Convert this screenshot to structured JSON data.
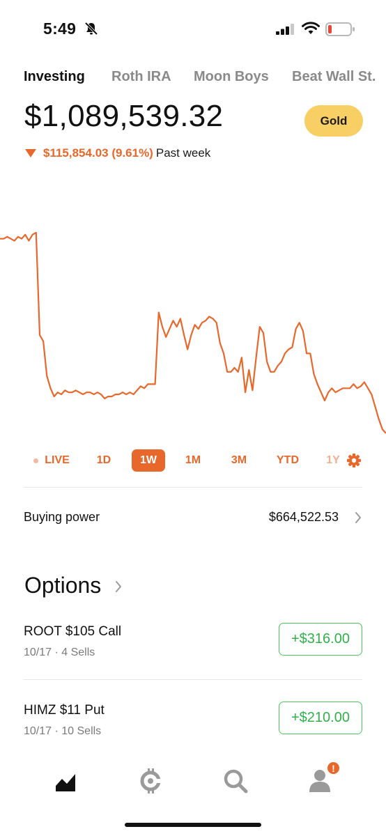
{
  "status_bar": {
    "time": "5:49"
  },
  "account_tabs": [
    {
      "label": "Investing",
      "active": true
    },
    {
      "label": "Roth IRA",
      "active": false
    },
    {
      "label": "Moon Boys",
      "active": false
    },
    {
      "label": "Beat Wall St.",
      "active": false
    }
  ],
  "portfolio": {
    "balance": "$1,089,539.32",
    "gold_label": "Gold",
    "change": "$115,854.03 (9.61%)",
    "change_period": "Past week",
    "change_direction": "down"
  },
  "chart_data": {
    "type": "line",
    "range": "1W",
    "color": "#e8672b",
    "y_relative": [
      0.95,
      0.95,
      0.96,
      0.95,
      0.94,
      0.96,
      0.95,
      0.97,
      0.94,
      0.97,
      0.98,
      0.48,
      0.45,
      0.28,
      0.22,
      0.18,
      0.2,
      0.19,
      0.21,
      0.2,
      0.2,
      0.21,
      0.2,
      0.19,
      0.2,
      0.2,
      0.19,
      0.2,
      0.19,
      0.17,
      0.18,
      0.18,
      0.19,
      0.19,
      0.2,
      0.19,
      0.2,
      0.19,
      0.21,
      0.23,
      0.22,
      0.24,
      0.24,
      0.24,
      0.59,
      0.52,
      0.47,
      0.51,
      0.55,
      0.52,
      0.56,
      0.48,
      0.41,
      0.48,
      0.53,
      0.51,
      0.54,
      0.55,
      0.57,
      0.56,
      0.54,
      0.44,
      0.39,
      0.3,
      0.3,
      0.32,
      0.3,
      0.37,
      0.2,
      0.31,
      0.21,
      0.37,
      0.52,
      0.49,
      0.35,
      0.3,
      0.3,
      0.33,
      0.35,
      0.39,
      0.41,
      0.42,
      0.51,
      0.54,
      0.5,
      0.39,
      0.39,
      0.29,
      0.24,
      0.2,
      0.16,
      0.2,
      0.22,
      0.2,
      0.21,
      0.22,
      0.22,
      0.22,
      0.24,
      0.22,
      0.23,
      0.25,
      0.22,
      0.19,
      0.13,
      0.07,
      0.02,
      0.0
    ]
  },
  "ranges": [
    {
      "label": "LIVE",
      "selected": false
    },
    {
      "label": "1D",
      "selected": false
    },
    {
      "label": "1W",
      "selected": true
    },
    {
      "label": "1M",
      "selected": false
    },
    {
      "label": "3M",
      "selected": false
    },
    {
      "label": "YTD",
      "selected": false
    },
    {
      "label": "1Y",
      "selected": false
    }
  ],
  "buying_power": {
    "label": "Buying power",
    "value": "$664,522.53"
  },
  "options": {
    "title": "Options",
    "positions": [
      {
        "name": "ROOT $105 Call",
        "detail": "10/17 · 4 Sells",
        "pl": "+$316.00"
      },
      {
        "name": "HIMZ $11 Put",
        "detail": "10/17 · 10 Sells",
        "pl": "+$210.00"
      }
    ]
  },
  "nav": {
    "items": [
      "chart-icon",
      "crypto-icon",
      "search-icon",
      "account-icon"
    ],
    "badge": "!"
  },
  "colors": {
    "accent": "#e8672b",
    "gold": "#f8cf64",
    "gain": "#2fb14a"
  }
}
